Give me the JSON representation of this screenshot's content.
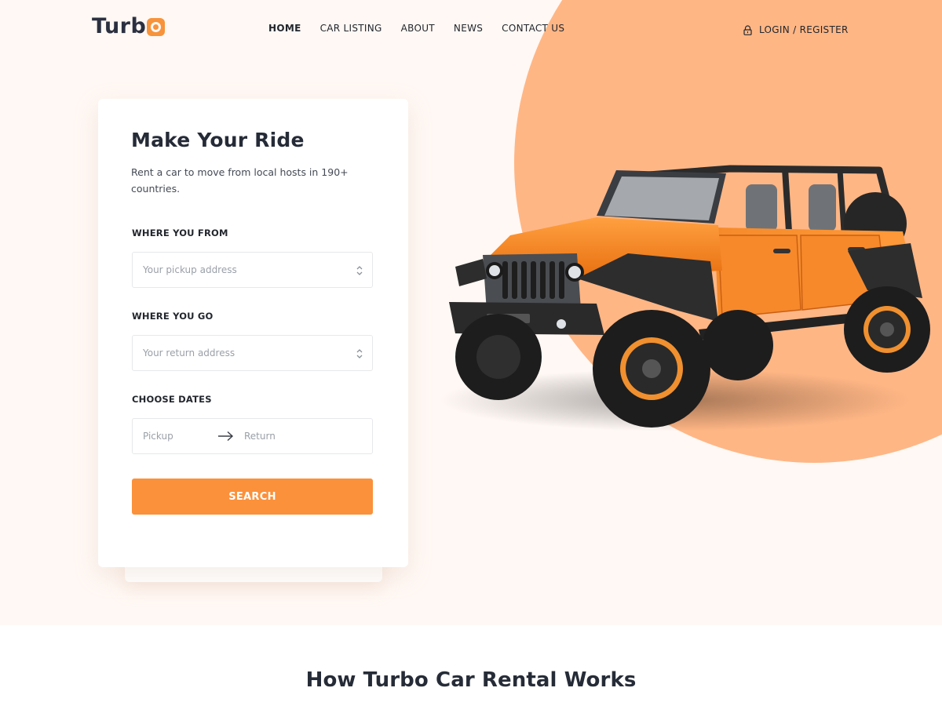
{
  "brand": {
    "name_prefix": "Turb",
    "accent": "#f7933b",
    "dark": "#2b3040"
  },
  "nav": {
    "items": [
      {
        "label": "HOME",
        "active": true
      },
      {
        "label": "CAR LISTING",
        "active": false
      },
      {
        "label": "ABOUT",
        "active": false
      },
      {
        "label": "NEWS",
        "active": false
      },
      {
        "label": "CONTACT US",
        "active": false
      }
    ]
  },
  "auth": {
    "login_label": "LOGIN / REGISTER",
    "icon": "lock-icon"
  },
  "search_card": {
    "title": "Make Your Ride",
    "subtitle": "Rent a car to move from local hosts in 190+ countries.",
    "from": {
      "label": "WHERE YOU FROM",
      "placeholder": "Your pickup address"
    },
    "to": {
      "label": "WHERE YOU GO",
      "placeholder": "Your return address"
    },
    "dates": {
      "label": "CHOOSE DATES",
      "pickup_placeholder": "Pickup",
      "return_placeholder": "Return"
    },
    "button_label": "SEARCH",
    "button_color": "#fb913b"
  },
  "hero_bg": {
    "page": "#fff8f4",
    "circle": "#ffb685"
  },
  "section": {
    "title": "How Turbo Car Rental Works"
  }
}
